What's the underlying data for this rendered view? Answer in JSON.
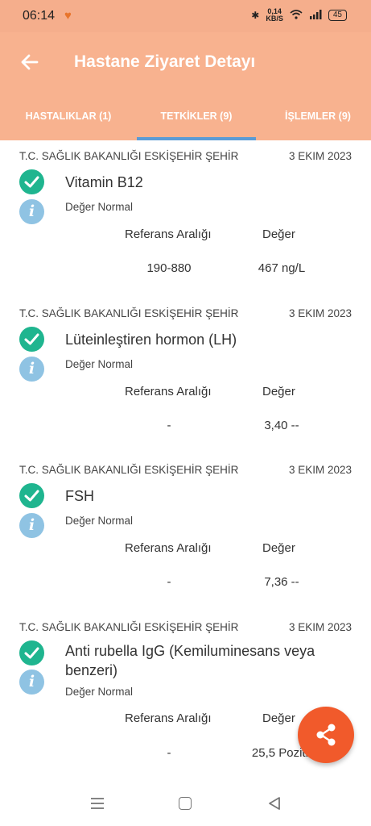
{
  "status_bar": {
    "time": "06:14",
    "speed_value": "0,14",
    "speed_unit": "KB/S",
    "battery": "45"
  },
  "header": {
    "title": "Hastane Ziyaret Detayı",
    "back_icon": "arrow-left-icon"
  },
  "tabs": [
    {
      "label": "HASTALIKLAR (1)",
      "active": false
    },
    {
      "label": "TETKİKLER (9)",
      "active": true
    },
    {
      "label": "İŞLEMLER (9)",
      "active": false
    }
  ],
  "records": [
    {
      "hospital": "T.C. SAĞLIK BAKANLIĞI ESKİŞEHİR ŞEHİR",
      "date": "3 EKIM 2023",
      "test_name": "Vitamin B12",
      "status": "Değer Normal",
      "ref_label": "Referans Aralığı",
      "value_label": "Değer",
      "ref_range": "190-880",
      "value": "467 ng/L"
    },
    {
      "hospital": "T.C. SAĞLIK BAKANLIĞI ESKİŞEHİR ŞEHİR",
      "date": "3 EKIM 2023",
      "test_name": "Lüteinleştiren hormon (LH)",
      "status": "Değer Normal",
      "ref_label": "Referans Aralığı",
      "value_label": "Değer",
      "ref_range": "-",
      "value": "3,40 --"
    },
    {
      "hospital": "T.C. SAĞLIK BAKANLIĞI ESKİŞEHİR ŞEHİR",
      "date": "3 EKIM 2023",
      "test_name": "FSH",
      "status": "Değer Normal",
      "ref_label": "Referans Aralığı",
      "value_label": "Değer",
      "ref_range": "-",
      "value": "7,36 --"
    },
    {
      "hospital": "T.C. SAĞLIK BAKANLIĞI ESKİŞEHİR ŞEHİR",
      "date": "3 EKIM 2023",
      "test_name": "Anti rubella IgG (Kemiluminesans veya benzeri)",
      "status": "Değer Normal",
      "ref_label": "Referans Aralığı",
      "value_label": "Değer",
      "ref_range": "-",
      "value": "25,5 Pozitif"
    }
  ],
  "fab_icon": "share-icon",
  "colors": {
    "appbar": "#f8b28f",
    "status_bar": "#f5ae8c",
    "check": "#1fb58f",
    "info": "#8fc3e3",
    "tab_indicator": "#5b9bd5",
    "fab": "#f15a2b"
  }
}
